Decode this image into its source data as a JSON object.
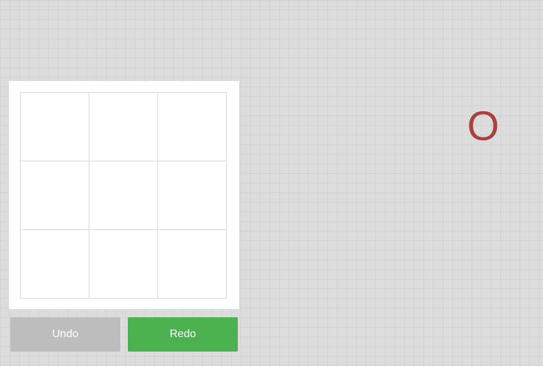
{
  "board": {
    "cells": [
      "",
      "",
      "",
      "",
      "",
      "",
      "",
      "",
      ""
    ]
  },
  "controls": {
    "undo_label": "Undo",
    "redo_label": "Redo"
  },
  "turn": {
    "symbol": "O",
    "color": "#a84140"
  },
  "colors": {
    "undo_bg": "#bdbdbd",
    "redo_bg": "#4caf50",
    "page_bg": "#dcdcdc"
  }
}
